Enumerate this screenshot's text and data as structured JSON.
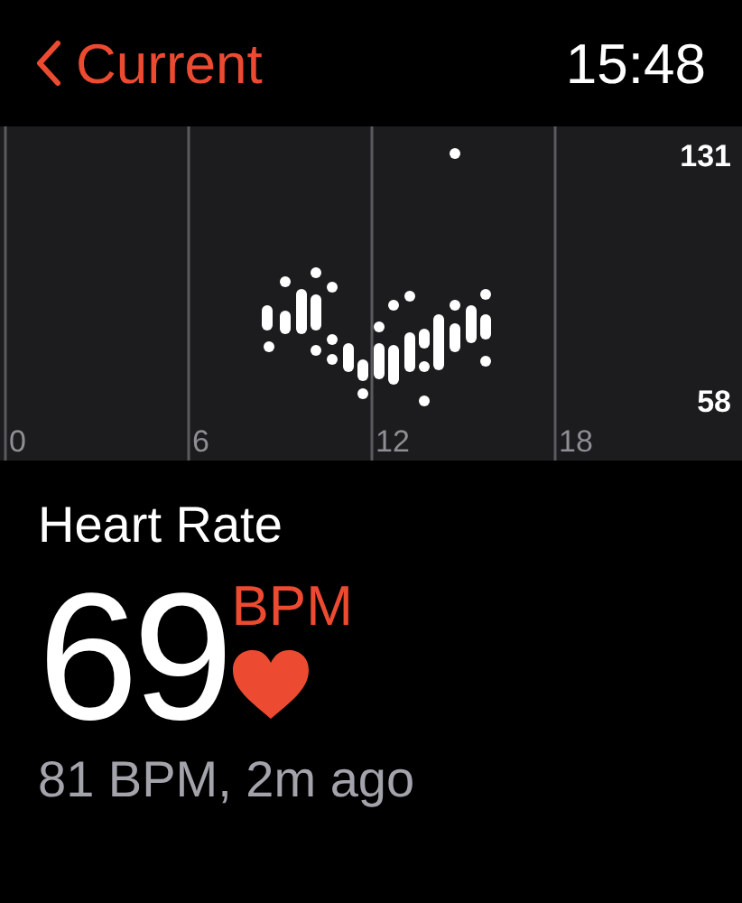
{
  "header": {
    "back_label": "Current",
    "time": "15:48"
  },
  "chart": {
    "x_labels": [
      "0",
      "6",
      "12",
      "18"
    ],
    "y_labels": [
      "131",
      "58"
    ]
  },
  "title": "Heart Rate",
  "value": "69",
  "unit": "BPM",
  "last_reading": "81 BPM, 2m ago"
}
